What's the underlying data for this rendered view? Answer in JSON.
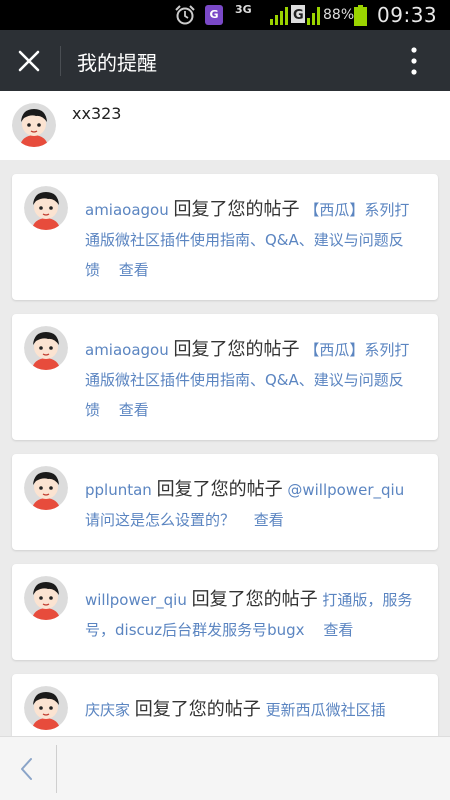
{
  "status_bar": {
    "net_3g": "3G",
    "net_3g_1x": "3G 1X",
    "sim_letter": "G",
    "gapp_letter": "G",
    "battery_percent": "88%",
    "time": "09:33"
  },
  "titlebar": {
    "title": "我的提醒",
    "close_icon": "close-icon",
    "more_icon": "more-vertical-icon"
  },
  "user": {
    "name": "xx323"
  },
  "notifications": [
    {
      "user": "amiaoagou",
      "action": "回复了您的帖子",
      "content": "【西瓜】系列打通版微社区插件使用指南、Q&A、建议与问题反馈",
      "view": "查看"
    },
    {
      "user": "amiaoagou",
      "action": "回复了您的帖子",
      "content": "【西瓜】系列打通版微社区插件使用指南、Q&A、建议与问题反馈",
      "view": "查看"
    },
    {
      "user": "ppluntan",
      "action": "回复了您的帖子",
      "content": "@willpower_qiu 请问这是怎么设置的？",
      "view": "查看"
    },
    {
      "user": "willpower_qiu",
      "action": "回复了您的帖子",
      "content": "打通版，服务号，discuz后台群发服务号bugx",
      "view": "查看"
    },
    {
      "user": "庆庆家",
      "action": "回复了您的帖子",
      "content": "更新西瓜微社区插",
      "view": ""
    }
  ],
  "colors": {
    "titlebar_bg": "#2c3035",
    "link": "#5b85c1",
    "page_bg": "#ebebeb"
  }
}
